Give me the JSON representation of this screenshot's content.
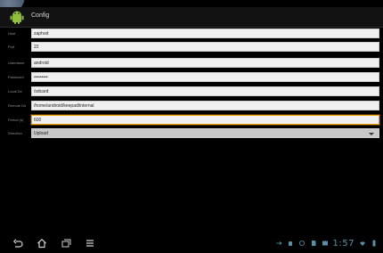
{
  "app": {
    "title": "Config"
  },
  "form": {
    "fields": [
      {
        "label": "Host",
        "value": "zaphod",
        "focused": false
      },
      {
        "label": "Port",
        "value": "22",
        "focused": false
      },
      {
        "label": "Username",
        "value": "android",
        "focused": false
      },
      {
        "label": "Password",
        "value": "•••••••••",
        "focused": false
      },
      {
        "label": "Local Dir",
        "value": "/sdcard",
        "focused": false
      },
      {
        "label": "Remote Dir",
        "value": "/home/android/keepad/internal",
        "focused": false
      },
      {
        "label": "Period (s)",
        "value": "600",
        "focused": true
      },
      {
        "label": "Direction",
        "value": "Upload",
        "focused": false,
        "select": true
      }
    ]
  },
  "system_bar": {
    "nav_icons": [
      "back-icon",
      "home-icon",
      "recent-apps-icon",
      "menu-icon"
    ],
    "status_icons": [
      "usb-icon",
      "debug-icon",
      "sync-icon",
      "sd-card-icon",
      "gallery-icon"
    ],
    "clock": "1:57",
    "colors": {
      "accent": "#5b8fa6",
      "focus": "#f6a200",
      "background": "#000000"
    }
  }
}
